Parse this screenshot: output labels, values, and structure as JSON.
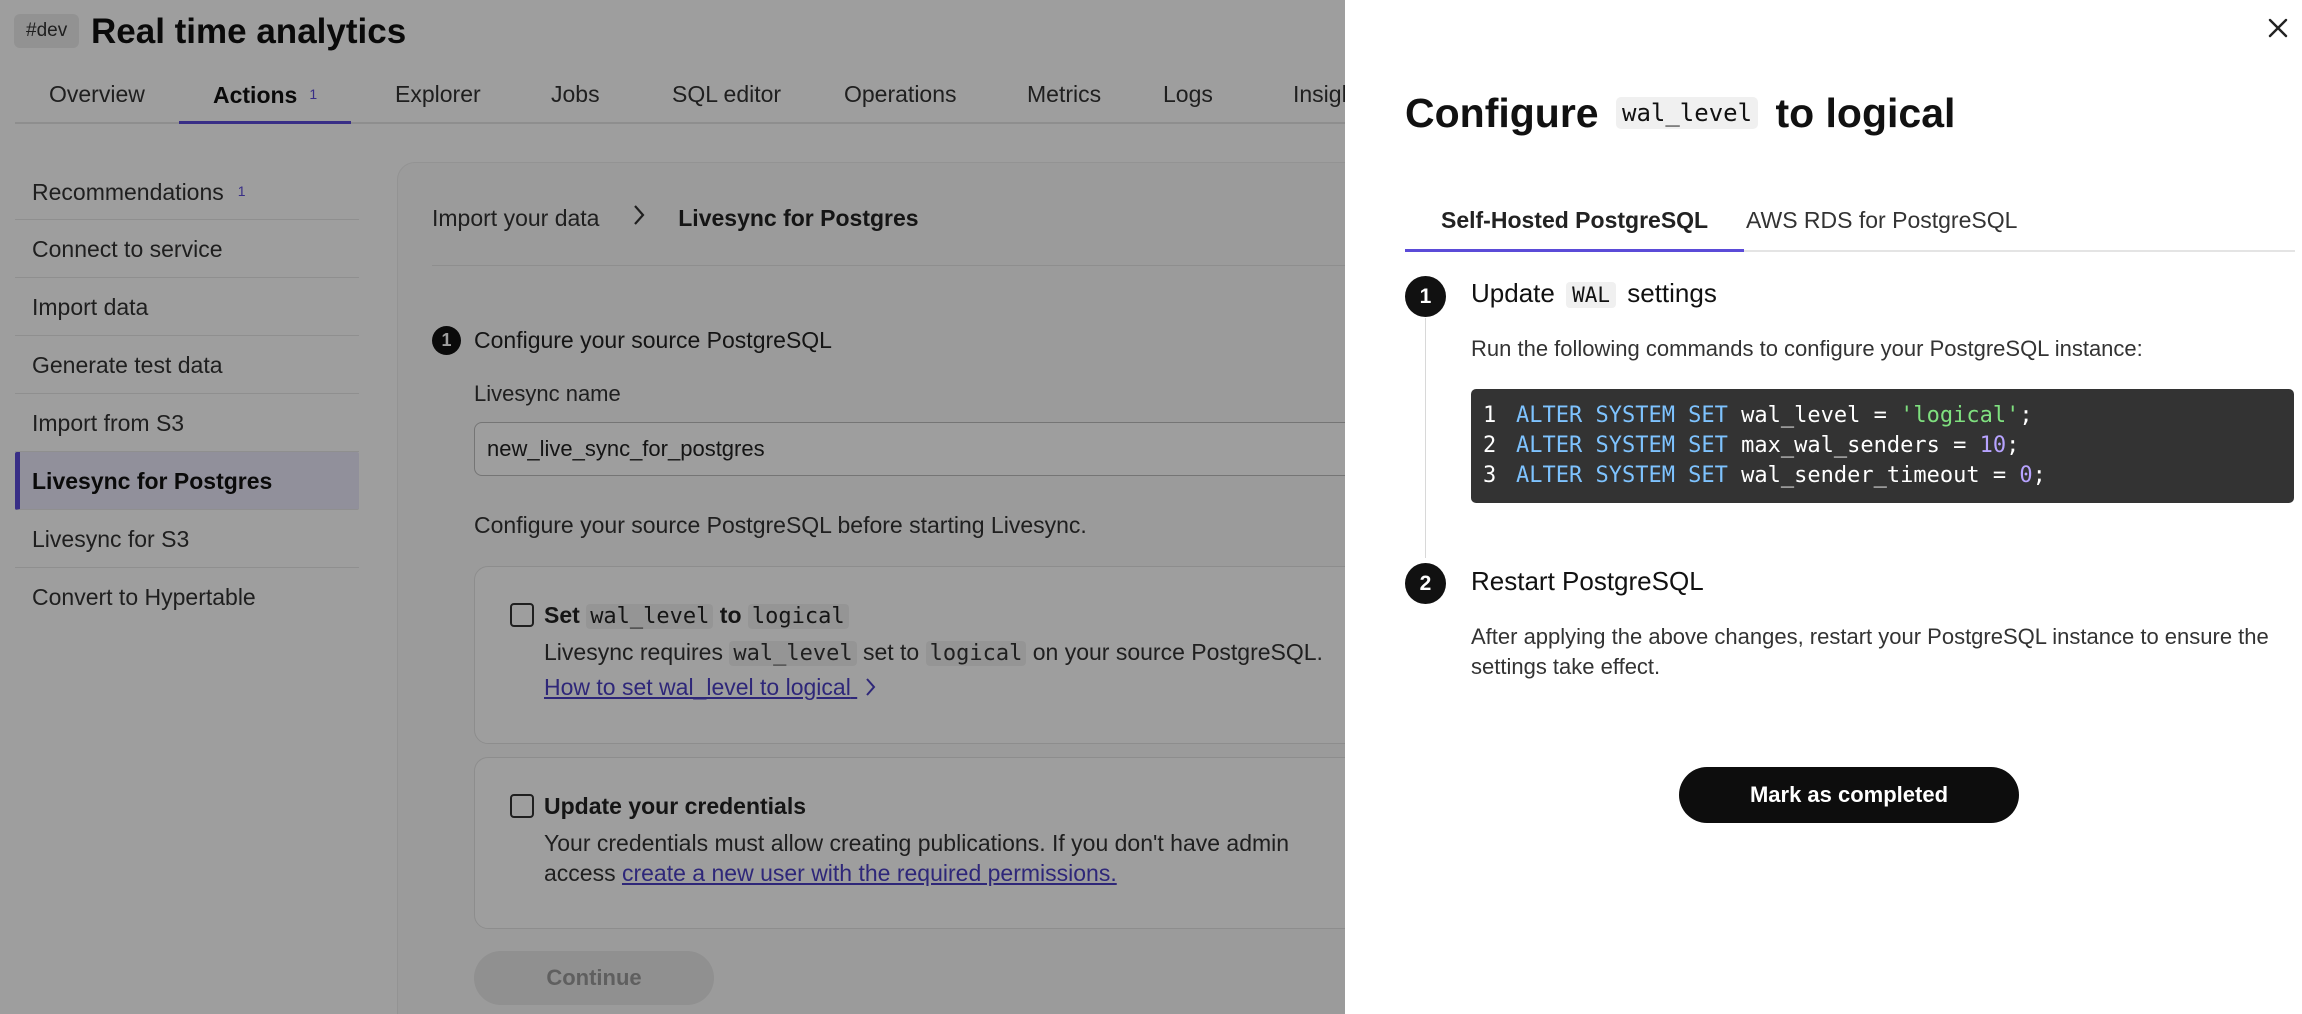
{
  "header": {
    "env_badge": "#dev",
    "title": "Real time analytics"
  },
  "tabs": [
    {
      "label": "Overview"
    },
    {
      "label": "Actions",
      "count": "1"
    },
    {
      "label": "Explorer"
    },
    {
      "label": "Jobs"
    },
    {
      "label": "SQL editor"
    },
    {
      "label": "Operations"
    },
    {
      "label": "Metrics"
    },
    {
      "label": "Logs"
    },
    {
      "label": "Insights"
    }
  ],
  "sidebar": {
    "items": [
      {
        "label": "Recommendations",
        "count": "1"
      },
      {
        "label": "Connect to service"
      },
      {
        "label": "Import data"
      },
      {
        "label": "Generate test data"
      },
      {
        "label": "Import from S3"
      },
      {
        "label": "Livesync for Postgres"
      },
      {
        "label": "Livesync for S3"
      },
      {
        "label": "Convert to Hypertable"
      }
    ]
  },
  "breadcrumb": {
    "parent": "Import your data",
    "current": "Livesync for Postgres"
  },
  "form": {
    "step_number": "1",
    "step_title": "Configure your source PostgreSQL",
    "name_label": "Livesync name",
    "name_value": "new_live_sync_for_postgres",
    "hint": "Configure your source PostgreSQL before starting Livesync.",
    "task1": {
      "title_pre": "Set",
      "title_code1": "wal_level",
      "title_mid": "to",
      "title_code2": "logical",
      "desc_pre": "Livesync requires",
      "desc_code1": "wal_level",
      "desc_mid": "set to",
      "desc_code2": "logical",
      "desc_post": "on your source PostgreSQL.",
      "link": "How to set wal_level to logical"
    },
    "task2": {
      "title": "Update your credentials",
      "desc": "Your credentials must allow creating publications. If you don't have admin access",
      "link": "create a new user with the required permissions."
    },
    "continue_label": "Continue"
  },
  "drawer": {
    "title_pre": "Configure",
    "title_code": "wal_level",
    "title_post": "to logical",
    "tabs": [
      {
        "label": "Self-Hosted PostgreSQL"
      },
      {
        "label": "AWS RDS for PostgreSQL"
      }
    ],
    "step1": {
      "number": "1",
      "heading_pre": "Update",
      "heading_code": "WAL",
      "heading_post": "settings",
      "text": "Run the following commands to configure your PostgreSQL instance:"
    },
    "code": [
      {
        "n": "1",
        "kw": "ALTER SYSTEM SET",
        "param": "wal_level",
        "op": "=",
        "value": "'logical'",
        "value_type": "string"
      },
      {
        "n": "2",
        "kw": "ALTER SYSTEM SET",
        "param": "max_wal_senders",
        "op": "=",
        "value": "10",
        "value_type": "number"
      },
      {
        "n": "3",
        "kw": "ALTER SYSTEM SET",
        "param": "wal_sender_timeout",
        "op": "=",
        "value": "0",
        "value_type": "number"
      }
    ],
    "step2": {
      "number": "2",
      "heading": "Restart PostgreSQL",
      "text": "After applying the above changes, restart your PostgreSQL instance to ensure the settings take effect."
    },
    "mark_label": "Mark as completed"
  },
  "colors": {
    "accent": "#5b4bd8",
    "overlay": "rgba(0,0,0,0.38)",
    "code_bg": "#333333",
    "code_keyword": "#7ec3ff",
    "code_string": "#7fe07f",
    "code_number": "#b7a3ff"
  },
  "icons": {
    "close": "close-icon",
    "breadcrumb_separator": "chevron-right-icon",
    "link_arrow": "chevron-right-icon"
  }
}
